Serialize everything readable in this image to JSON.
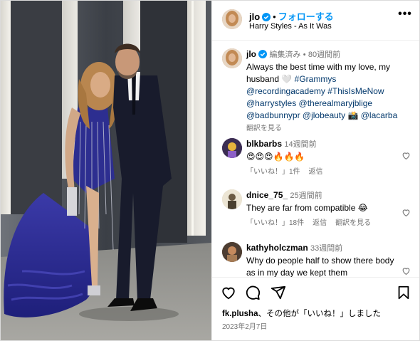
{
  "post": {
    "username": "jlo",
    "follow_label": "フォローする",
    "separator": "•",
    "song": "Harry Styles - As It Was",
    "more_label": "•••"
  },
  "caption": {
    "username": "jlo",
    "edited": "編集済み",
    "time": "80週間前",
    "text_main": "Always the best time with my love, my husband 🤍 ",
    "tags": "#Grammys @recordingacademy #ThisIsMeNow @harrystyles @therealmaryjblige @badbunnypr @jlobeauty 📸 @lacarba",
    "translate": "翻訳を見る"
  },
  "comments": [
    {
      "username": "blkbarbs",
      "time": "14週間前",
      "text": "😍😍😍🔥🔥🔥",
      "likes": "「いいね！」1件",
      "reply": "返信",
      "translate": ""
    },
    {
      "username": "dnice_75_",
      "time": "25週間前",
      "text": "They are far from compatible 😂",
      "likes": "「いいね！」18件",
      "reply": "返信",
      "translate": "翻訳を見る"
    },
    {
      "username": "kathyholczman",
      "time": "33週間前",
      "text": "Why do people half to show there body as in my day we kept them",
      "likes": "",
      "reply": "",
      "translate": ""
    }
  ],
  "footer": {
    "liked_by_user": "fk.plusha",
    "liked_by_rest": "、その他が「いいね！」しました",
    "date": "2023年2月7日"
  },
  "icons": {
    "verified": "verified-badge-icon",
    "like": "heart-icon",
    "comment": "comment-icon",
    "share": "send-icon",
    "save": "bookmark-icon",
    "more": "more-options-icon"
  },
  "colors": {
    "link": "#0095f6",
    "hashtag": "#00376b",
    "muted": "#737373",
    "border": "#efefef"
  }
}
